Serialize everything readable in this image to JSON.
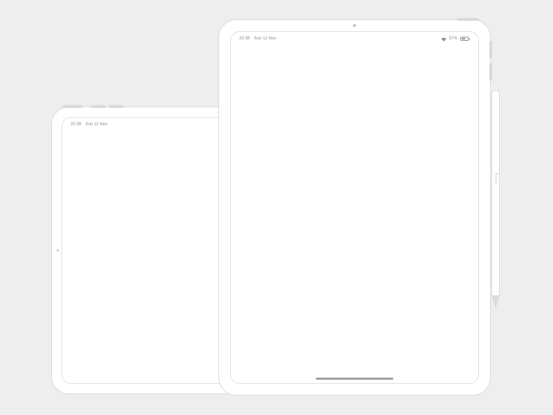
{
  "ipad11": {
    "status": {
      "time": "20:38",
      "date": "Sun 11 Nov"
    }
  },
  "ipad129": {
    "status": {
      "time": "20:38",
      "date": "Sun 11 Nov",
      "battery_percent": "57%"
    }
  },
  "pencil": {
    "brand_glyph": "",
    "label": "Pencil"
  }
}
